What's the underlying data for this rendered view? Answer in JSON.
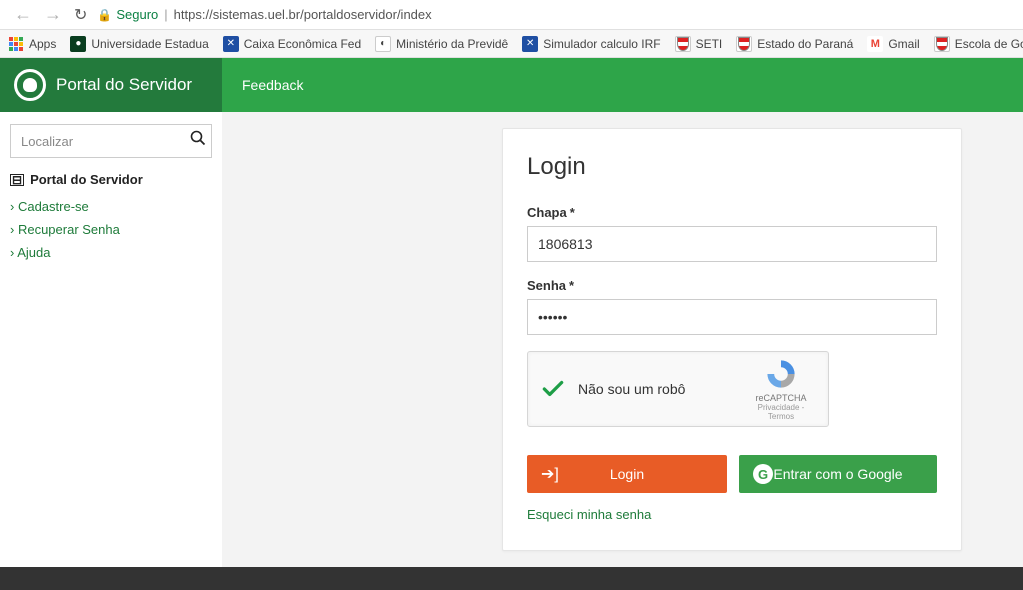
{
  "browser": {
    "secure_label": "Seguro",
    "url": "https://sistemas.uel.br/portaldoservidor/index"
  },
  "bookmarks": {
    "apps": "Apps",
    "items": [
      "Universidade Estadua",
      "Caixa Econômica Fed",
      "Ministério da Previdê",
      "Simulador calculo IRF",
      "SETI",
      "Estado do Paraná",
      "Gmail",
      "Escola de Governo"
    ]
  },
  "header": {
    "brand": "Portal do Servidor",
    "feedback": "Feedback"
  },
  "sidebar": {
    "search_placeholder": "Localizar",
    "heading": "Portal do Servidor",
    "links": [
      "Cadastre-se",
      "Recuperar Senha",
      "Ajuda"
    ]
  },
  "login": {
    "title": "Login",
    "chapa_label": "Chapa",
    "chapa_value": "1806813",
    "senha_label": "Senha",
    "senha_value": "••••••",
    "recaptcha_label": "Não sou um robô",
    "recaptcha_brand": "reCAPTCHA",
    "recaptcha_terms": "Privacidade - Termos",
    "login_btn": "Login",
    "google_btn": "Entrar com o Google",
    "forgot": "Esqueci minha senha"
  }
}
